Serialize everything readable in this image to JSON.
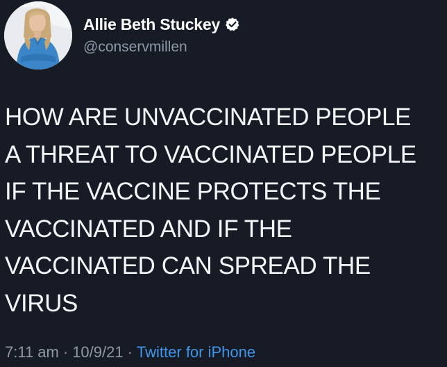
{
  "tweet": {
    "author": {
      "display_name": "Allie Beth Stuckey",
      "handle": "@conservmillen",
      "verified": true,
      "avatar": "profile-photo"
    },
    "text_lines": [
      "HOW ARE UNVACCINATED PEOPLE",
      "A THREAT TO VACCINATED PEOPLE",
      "IF THE VACCINE PROTECTS THE",
      "VACCINATED AND IF THE",
      "VACCINATED CAN SPREAD THE",
      "VIRUS"
    ],
    "meta": {
      "time": "7:11 am",
      "separator": "·",
      "date": "10/9/21",
      "source": "Twitter for iPhone"
    }
  },
  "colors": {
    "background": "#161b26",
    "text": "#f5f6f8",
    "muted": "#8e99a6",
    "link": "#3f95e8"
  }
}
